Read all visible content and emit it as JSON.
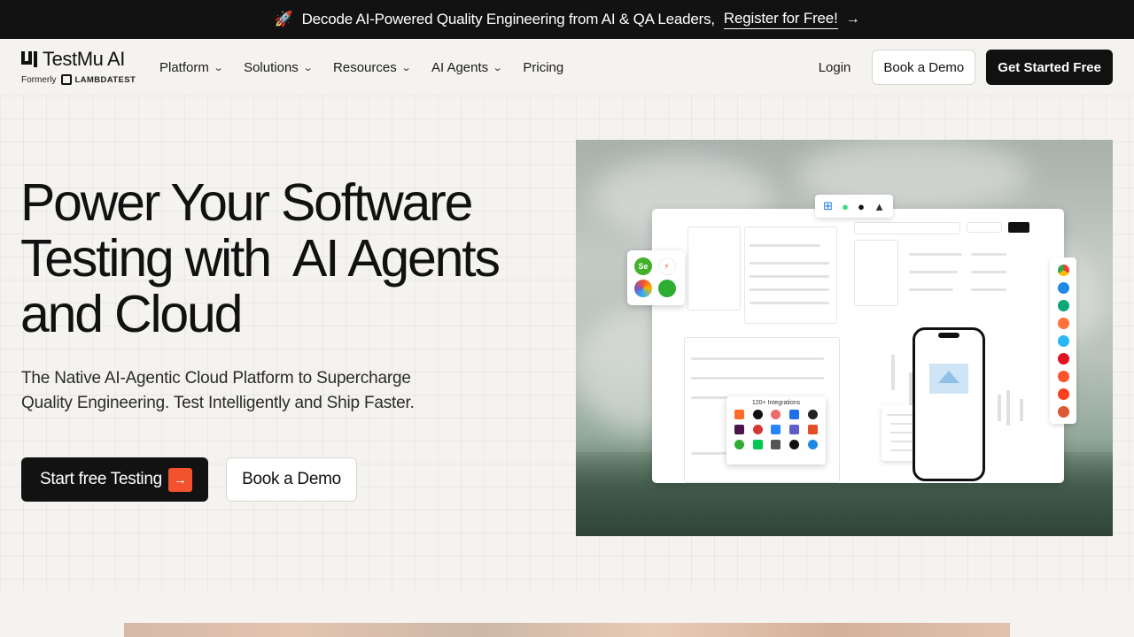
{
  "announcement": {
    "icon": "rocket-icon",
    "text": "Decode AI-Powered Quality Engineering from AI & QA Leaders,",
    "link_label": "Register for Free!",
    "arrow": "→"
  },
  "logo": {
    "name": "TestMu AI",
    "formerly": "Formerly",
    "former_brand": "LAMBDATEST"
  },
  "nav": {
    "items": [
      {
        "label": "Platform",
        "has_dropdown": true
      },
      {
        "label": "Solutions",
        "has_dropdown": true
      },
      {
        "label": "Resources",
        "has_dropdown": true
      },
      {
        "label": "AI Agents",
        "has_dropdown": true
      },
      {
        "label": "Pricing",
        "has_dropdown": false
      }
    ],
    "login": "Login",
    "book_demo": "Book a Demo",
    "get_started": "Get Started Free"
  },
  "hero": {
    "title_line1": "Power Your Software",
    "title_line2": "Testing with  AI Agents",
    "title_line3": "and Cloud",
    "subtitle_line1": "The Native AI-Agentic Cloud Platform to Supercharge",
    "subtitle_line2": "Quality Engineering. Test Intelligently and Ship Faster.",
    "cta_primary": "Start free Testing",
    "cta_primary_arrow": "→",
    "cta_secondary": "Book a Demo"
  },
  "hero_image": {
    "integrations_title": "120+ Integrations",
    "os_icons": [
      "windows-icon",
      "android-icon",
      "apple-icon",
      "linux-icon"
    ],
    "browser_icons": [
      "chrome-icon",
      "safari-icon",
      "edge-icon",
      "firefox-icon",
      "ie-icon",
      "opera-icon",
      "brave-icon",
      "yandex-icon",
      "duckduckgo-icon"
    ]
  },
  "colors": {
    "accent": "#f2522e",
    "dark": "#121212",
    "background": "#f5f3ef"
  }
}
